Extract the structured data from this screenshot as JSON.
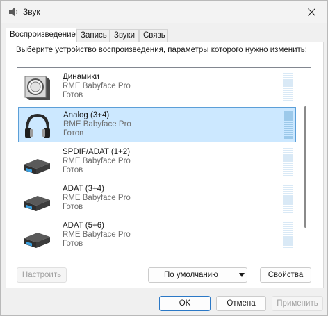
{
  "window": {
    "title": "Звук",
    "icon": "speaker-icon",
    "close_icon": "close-icon"
  },
  "tabs": [
    {
      "label": "Воспроизведение",
      "active": true
    },
    {
      "label": "Запись",
      "active": false
    },
    {
      "label": "Звуки",
      "active": false
    },
    {
      "label": "Связь",
      "active": false
    }
  ],
  "prompt": "Выберите устройство воспроизведения, параметры которого нужно изменить:",
  "devices": [
    {
      "name": "Динамики",
      "device": "RME Babyface Pro",
      "status": "Готов",
      "icon": "speaker-device-icon",
      "selected": false
    },
    {
      "name": "Analog (3+4)",
      "device": "RME Babyface Pro",
      "status": "Готов",
      "icon": "headphones-icon",
      "selected": true
    },
    {
      "name": "SPDIF/ADAT (1+2)",
      "device": "RME Babyface Pro",
      "status": "Готов",
      "icon": "digital-output-icon",
      "selected": false
    },
    {
      "name": "ADAT (3+4)",
      "device": "RME Babyface Pro",
      "status": "Готов",
      "icon": "digital-output-icon",
      "selected": false
    },
    {
      "name": "ADAT (5+6)",
      "device": "RME Babyface Pro",
      "status": "Готов",
      "icon": "digital-output-icon",
      "selected": false
    }
  ],
  "buttons": {
    "configure": "Настроить",
    "default": "По умолчанию",
    "properties": "Свойства",
    "ok": "OK",
    "cancel": "Отмена",
    "apply": "Применить"
  },
  "colors": {
    "selection": "#cce8ff",
    "selection_border": "#5c9fd8",
    "accent": "#2b78c6"
  }
}
